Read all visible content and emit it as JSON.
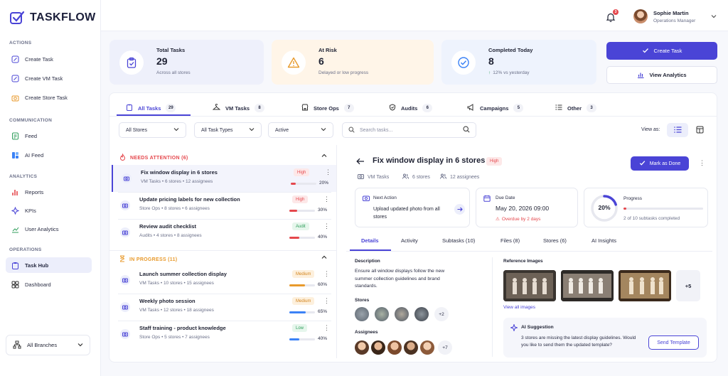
{
  "app": {
    "name": "TASKFLOW",
    "brand_color": "#4a44d6"
  },
  "sidebar": {
    "sections": [
      {
        "title": "ACTIONS",
        "items": [
          {
            "label": "Create Task",
            "icon": "edit-square-icon"
          },
          {
            "label": "Create VM Task",
            "icon": "edit-square-icon"
          },
          {
            "label": "Create Store Task",
            "icon": "camera-icon"
          }
        ]
      },
      {
        "title": "COMMUNICATION",
        "items": [
          {
            "label": "Feed",
            "icon": "feed-icon"
          },
          {
            "label": "AI Feed",
            "icon": "ai-feed-icon"
          }
        ]
      },
      {
        "title": "ANALYTICS",
        "items": [
          {
            "label": "Reports",
            "icon": "bar-chart-icon"
          },
          {
            "label": "KPIs",
            "icon": "sparkle-icon"
          },
          {
            "label": "User Analytics",
            "icon": "line-chart-icon"
          }
        ]
      },
      {
        "title": "OPERATIONS",
        "items": [
          {
            "label": "Task Hub",
            "icon": "clipboard-icon",
            "active": true
          },
          {
            "label": "Dashboard",
            "icon": "grid-icon"
          }
        ]
      }
    ],
    "branch": {
      "label": "All Branches"
    }
  },
  "topbar": {
    "notifications": "3",
    "user": {
      "name": "Sophie Martin",
      "role": "Operations Manager"
    }
  },
  "stats": [
    {
      "title": "Total Tasks",
      "value": "29",
      "sub": "Across all stores",
      "bg": "#eef0fb",
      "accent": "#4a44d6"
    },
    {
      "title": "At Risk",
      "value": "6",
      "sub": "Delayed or low progress",
      "bg": "#fff5e8",
      "accent": "#e89a2c"
    },
    {
      "title": "Completed Today",
      "value": "8",
      "sub": "12% vs yesterday",
      "bg": "#eef3fd",
      "accent": "#3b82f6"
    }
  ],
  "actions": {
    "create": "Create Task",
    "analytics": "View Analytics"
  },
  "tabs": [
    {
      "label": "All Tasks",
      "count": "29"
    },
    {
      "label": "VM Tasks",
      "count": "8"
    },
    {
      "label": "Store Ops",
      "count": "7"
    },
    {
      "label": "Audits",
      "count": "6"
    },
    {
      "label": "Campaigns",
      "count": "5"
    },
    {
      "label": "Other",
      "count": "3"
    }
  ],
  "filters": {
    "stores": "All Stores",
    "types": "All Task Types",
    "status": "Active",
    "search_placeholder": "Search tasks...",
    "view_as": "View as:"
  },
  "groups": {
    "attention": {
      "title": "NEEDS ATTENTION (6)",
      "color": "#e5484d"
    },
    "progress": {
      "title": "IN PROGRESS (11)",
      "color": "#e89a2c"
    }
  },
  "tasks": [
    {
      "title": "Fix window display in 6 stores",
      "meta": "VM Tasks  •  6 stores  •  12 assignees",
      "badge": "High",
      "progress": 0.2,
      "pct": "20%",
      "color": "#e5484d"
    },
    {
      "title": "Update pricing labels for new collection",
      "meta": "Store Ops  •  8 stores  •  6 assignees",
      "badge": "High",
      "progress": 0.3,
      "pct": "30%",
      "color": "#e5484d"
    },
    {
      "title": "Review audit checklist",
      "meta": "Audits  •  4 stores  •  8 assignees",
      "badge": "Audit",
      "progress": 0.4,
      "pct": "40%",
      "color": "#e5484d"
    },
    {
      "title": "Launch summer collection display",
      "meta": "VM Tasks  •  10 stores  •  15 assignees",
      "badge": "Medium",
      "progress": 0.6,
      "pct": "60%",
      "color": "#e89a2c"
    },
    {
      "title": "Weekly photo session",
      "meta": "VM Tasks  •  12 stores  •  18 assignees",
      "badge": "Medium",
      "progress": 0.65,
      "pct": "65%",
      "color": "#3b82f6"
    },
    {
      "title": "Staff training - product knowledge",
      "meta": "Store Ops  •  5 stores  •  7 assignees",
      "badge": "Low",
      "progress": 0.4,
      "pct": "40%",
      "color": "#3b82f6"
    }
  ],
  "detail": {
    "title": "Fix window display in 6 stores",
    "priority": "High",
    "meta": {
      "type": "VM Tasks",
      "stores": "6 stores",
      "assignees": "12 assignees"
    },
    "mark_done": "Mark as Done",
    "next_action": {
      "label": "Next Action",
      "text": "Upload updated photo from all stores"
    },
    "due": {
      "label": "Due Date",
      "date": "May 20, 2026 09:00",
      "overdue": "Overdue by 2 days"
    },
    "progress": {
      "label": "Progress",
      "pct": "20%",
      "value": 0.2,
      "sub": "2 of 10 subtasks completed"
    },
    "tabs": [
      "Details",
      "Activity",
      "Subtasks (10)",
      "Files (8)",
      "Stores (6)",
      "AI Insights"
    ],
    "description_label": "Description",
    "description": "Ensure all window displays follow the new summer collection guidelines and brand standards.",
    "stores_label": "Stores",
    "stores_more": "+2",
    "assignees_label": "Assignees",
    "assignees_more": "+7",
    "ref_label": "Reference Images",
    "ref_more": "+5",
    "view_all": "View all images",
    "ai": {
      "title": "AI Suggestion",
      "text": "3 stores are missing the latest display guidelines. Would you like to send them the updated template?",
      "button": "Send Template"
    }
  }
}
